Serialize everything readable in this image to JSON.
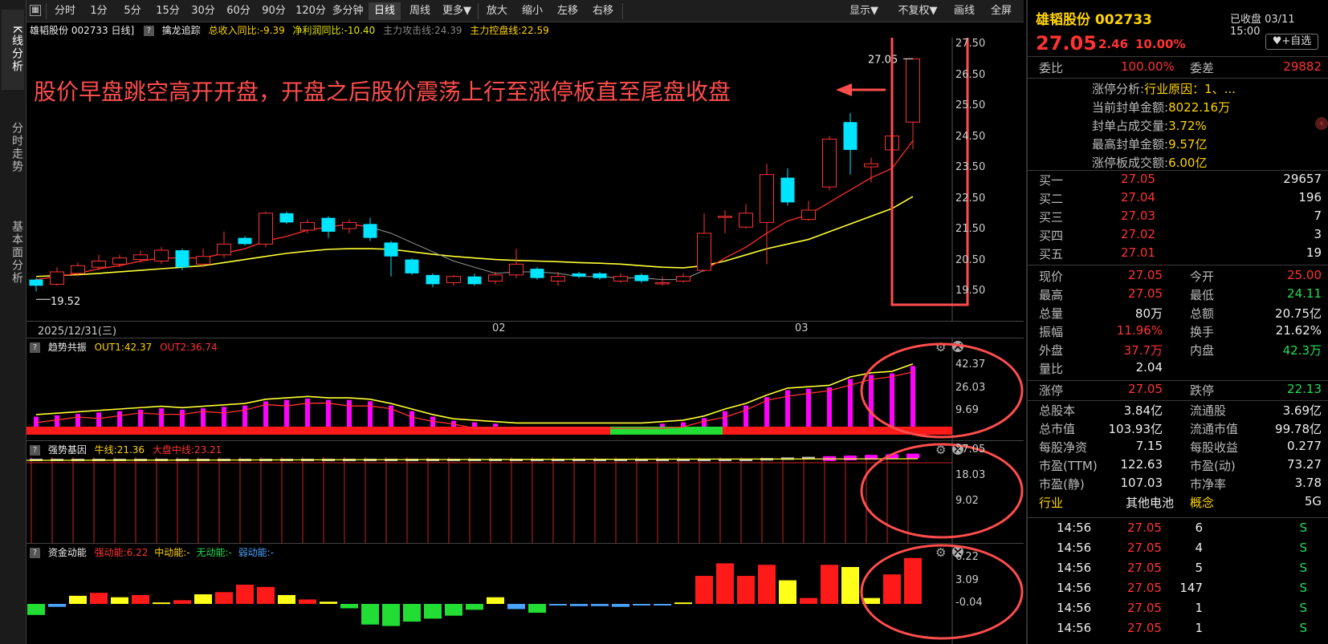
{
  "sidebar": {
    "tabs": [
      {
        "label": "K线分析",
        "active": true
      },
      {
        "label": "分时走势",
        "active": false
      },
      {
        "label": "基本面分析",
        "active": false
      }
    ]
  },
  "toolbar": {
    "periods": [
      "分时",
      "1分",
      "5分",
      "15分",
      "30分",
      "60分",
      "90分",
      "120分",
      "多分钟",
      "日线",
      "周线",
      "更多▼"
    ],
    "active_period": "日线",
    "actions": [
      "放大",
      "缩小",
      "左移",
      "右移"
    ],
    "right": [
      "显示▼",
      "不复权▼",
      "画线",
      "全屏"
    ]
  },
  "main_info": {
    "title": "雄韬股份 002733 日线]",
    "indicator": "擒龙追踪",
    "rev_yoy": "总收入同比:-9.39",
    "profit_yoy": "净利润同比:-10.40",
    "attack_line": "主力攻击线:24.39",
    "control_line": "主力控盘线:22.59"
  },
  "annotation": {
    "text": "股价早盘跳空高开开盘，开盘之后股价震荡上行至涨停板直至尾盘收盘"
  },
  "colors": {
    "up": "#ff3333",
    "down": "#00e5ff",
    "ma_yellow": "#ffff33",
    "ma_red": "#ff2a2a",
    "annotation": "#ff4d4d",
    "magenta": "#ff00ff"
  },
  "main_axis": {
    "ticks": [
      "27.50",
      "26.50",
      "25.50",
      "24.50",
      "23.50",
      "22.50",
      "21.50",
      "20.50",
      "19.50"
    ]
  },
  "date_axis": {
    "start": "2025/12/31(三)",
    "mid": "02",
    "end": "03"
  },
  "price_labels": {
    "high": "27.05",
    "low": "19.52"
  },
  "chart_data": [
    {
      "type": "candlestick",
      "title": "雄韬股份 002733 日线",
      "ylim": [
        19.5,
        27.5
      ],
      "candles": [
        {
          "o": 19.9,
          "c": 19.7,
          "h": 19.95,
          "l": 19.52
        },
        {
          "o": 19.75,
          "c": 20.15,
          "h": 20.3,
          "l": 19.7
        },
        {
          "o": 20.1,
          "c": 20.35,
          "h": 20.45,
          "l": 20.0
        },
        {
          "o": 20.3,
          "c": 20.5,
          "h": 20.7,
          "l": 20.2
        },
        {
          "o": 20.4,
          "c": 20.6,
          "h": 20.7,
          "l": 20.3
        },
        {
          "o": 20.55,
          "c": 20.7,
          "h": 20.85,
          "l": 20.45
        },
        {
          "o": 20.5,
          "c": 20.85,
          "h": 20.95,
          "l": 20.4
        },
        {
          "o": 20.85,
          "c": 20.3,
          "h": 20.9,
          "l": 20.2
        },
        {
          "o": 20.4,
          "c": 20.65,
          "h": 20.9,
          "l": 20.3
        },
        {
          "o": 20.7,
          "c": 21.05,
          "h": 21.45,
          "l": 20.6
        },
        {
          "o": 21.25,
          "c": 21.05,
          "h": 21.3,
          "l": 21.0
        },
        {
          "o": 21.05,
          "c": 22.05,
          "h": 22.1,
          "l": 20.95
        },
        {
          "o": 22.05,
          "c": 21.75,
          "h": 22.1,
          "l": 21.7
        },
        {
          "o": 21.5,
          "c": 21.75,
          "h": 21.85,
          "l": 21.4
        },
        {
          "o": 21.9,
          "c": 21.45,
          "h": 21.95,
          "l": 21.25
        },
        {
          "o": 21.55,
          "c": 21.75,
          "h": 21.85,
          "l": 21.4
        },
        {
          "o": 21.7,
          "c": 21.25,
          "h": 21.9,
          "l": 21.15
        },
        {
          "o": 21.1,
          "c": 20.65,
          "h": 21.15,
          "l": 20.0
        },
        {
          "o": 20.55,
          "c": 20.1,
          "h": 20.6,
          "l": 20.05
        },
        {
          "o": 20.05,
          "c": 19.75,
          "h": 20.1,
          "l": 19.65
        },
        {
          "o": 19.8,
          "c": 20.0,
          "h": 20.05,
          "l": 19.7
        },
        {
          "o": 20.0,
          "c": 19.75,
          "h": 20.1,
          "l": 19.7
        },
        {
          "o": 19.85,
          "c": 20.05,
          "h": 20.15,
          "l": 19.75
        },
        {
          "o": 20.05,
          "c": 20.4,
          "h": 20.9,
          "l": 19.95
        },
        {
          "o": 20.25,
          "c": 19.95,
          "h": 20.3,
          "l": 19.9
        },
        {
          "o": 19.85,
          "c": 20.0,
          "h": 20.15,
          "l": 19.7
        },
        {
          "o": 20.1,
          "c": 20.0,
          "h": 20.15,
          "l": 19.95
        },
        {
          "o": 20.1,
          "c": 19.95,
          "h": 20.15,
          "l": 19.9
        },
        {
          "o": 19.85,
          "c": 20.0,
          "h": 20.1,
          "l": 19.8
        },
        {
          "o": 20.05,
          "c": 19.85,
          "h": 20.1,
          "l": 19.8
        },
        {
          "o": 19.8,
          "c": 19.8,
          "h": 20.0,
          "l": 19.7
        },
        {
          "o": 19.85,
          "c": 20.0,
          "h": 20.1,
          "l": 19.8
        },
        {
          "o": 20.2,
          "c": 21.4,
          "h": 22.05,
          "l": 20.15
        },
        {
          "o": 21.95,
          "c": 21.95,
          "h": 22.15,
          "l": 21.4
        },
        {
          "o": 21.6,
          "c": 22.05,
          "h": 22.35,
          "l": 21.55
        },
        {
          "o": 21.75,
          "c": 23.3,
          "h": 23.65,
          "l": 20.4
        },
        {
          "o": 23.2,
          "c": 22.4,
          "h": 23.5,
          "l": 22.3
        },
        {
          "o": 21.85,
          "c": 22.15,
          "h": 22.45,
          "l": 21.8
        },
        {
          "o": 22.9,
          "c": 24.45,
          "h": 24.55,
          "l": 22.8
        },
        {
          "o": 25.0,
          "c": 24.1,
          "h": 25.3,
          "l": 23.3
        },
        {
          "o": 23.55,
          "c": 23.65,
          "h": 23.85,
          "l": 23.05
        },
        {
          "o": 24.1,
          "c": 24.55,
          "h": 25.95,
          "l": 24.05
        },
        {
          "o": 25.0,
          "c": 27.05,
          "h": 27.05,
          "l": 24.11
        }
      ],
      "ma_short": [
        19.9,
        20.0,
        20.1,
        20.25,
        20.35,
        20.5,
        20.6,
        20.6,
        20.6,
        20.75,
        20.9,
        21.15,
        21.3,
        21.5,
        21.6,
        21.7,
        21.6,
        21.4,
        21.1,
        20.8,
        20.5,
        20.3,
        20.1,
        20.15,
        20.15,
        20.1,
        20.0,
        20.0,
        19.95,
        19.95,
        19.9,
        19.9,
        20.2,
        20.6,
        20.95,
        21.4,
        21.8,
        22.0,
        22.4,
        22.8,
        23.2,
        23.5,
        24.4
      ],
      "ma_long": [
        20.0,
        20.03,
        20.06,
        20.1,
        20.15,
        20.2,
        20.25,
        20.3,
        20.35,
        20.45,
        20.55,
        20.65,
        20.75,
        20.82,
        20.88,
        20.9,
        20.9,
        20.88,
        20.8,
        20.72,
        20.65,
        20.6,
        20.55,
        20.52,
        20.5,
        20.48,
        20.45,
        20.43,
        20.4,
        20.35,
        20.3,
        20.28,
        20.35,
        20.5,
        20.7,
        20.9,
        21.05,
        21.2,
        21.45,
        21.7,
        21.95,
        22.2,
        22.59
      ]
    },
    {
      "type": "bar",
      "title": "趋势共振",
      "series": [
        {
          "name": "OUT1",
          "last": 42.37
        },
        {
          "name": "OUT2",
          "last": 36.74
        }
      ],
      "axis": {
        "ticks": [
          "42.37",
          "26.03",
          "9.69"
        ]
      },
      "values": [
        6,
        7,
        8,
        9,
        10,
        11,
        12,
        11,
        12,
        13,
        14,
        17,
        18,
        19,
        18,
        18,
        17,
        14,
        10,
        6,
        3,
        2,
        1,
        0,
        0,
        0,
        0,
        0,
        0,
        0,
        1,
        2,
        5,
        10,
        14,
        20,
        25,
        26,
        27,
        33,
        36,
        37,
        42.37
      ],
      "label_out1": "OUT1:42.37",
      "label_out2": "OUT2:36.74"
    },
    {
      "type": "bar",
      "title": "强势基因",
      "series": [
        {
          "name": "牛线",
          "last": 21.36
        },
        {
          "name": "大盘中线",
          "last": 23.21
        }
      ],
      "axis": {
        "ticks": [
          "27.05",
          "18.03",
          "9.02"
        ]
      },
      "label_bull": "牛线:21.36",
      "label_market": "大盘中线:23.21"
    },
    {
      "type": "bar",
      "title": "资金动能",
      "series": [
        {
          "name": "强动能",
          "last": 6.22
        },
        {
          "name": "中动能",
          "last": null
        },
        {
          "name": "无动能",
          "last": null
        },
        {
          "name": "弱动能",
          "last": null
        }
      ],
      "axis": {
        "ticks": [
          "6.22",
          "3.09",
          "-0.04"
        ]
      },
      "values": [
        -1.5,
        -0.4,
        1.1,
        1.5,
        0.9,
        1.2,
        0.2,
        0.5,
        1.3,
        1.6,
        2.6,
        2.3,
        1.2,
        0.6,
        0.3,
        -0.6,
        -2.8,
        -3.0,
        -2.4,
        -2.0,
        -1.6,
        -0.8,
        0.9,
        -0.7,
        -1.2,
        -0.2,
        -0.3,
        -0.3,
        -0.4,
        -0.2,
        -0.2,
        0.2,
        3.8,
        5.5,
        3.8,
        5.3,
        3.2,
        0.8,
        5.3,
        5.0,
        0.8,
        4.0,
        6.22
      ],
      "label_strong": "强动能:6.22",
      "label_mid": "中动能:-",
      "label_none": "无动能:-",
      "label_weak": "弱动能:-"
    }
  ],
  "quote": {
    "name": "雄韬股份 002733",
    "status": "已收盘 03/11 15:00",
    "price": "27.05",
    "change": "2.46",
    "pct": "10.00%",
    "fav_button": "+自选",
    "wei_bi_label": "委比",
    "wei_bi": "100.00%",
    "wei_cha_label": "委差",
    "wei_cha": "29882",
    "limit_analysis_label": "涨停分析:",
    "limit_analysis": "行业原因：1、...",
    "seal_amount_label": "当前封单金额:",
    "seal_amount": "8022.16万",
    "seal_ratio_label": "封单占成交量:",
    "seal_ratio": "3.72%",
    "max_seal_label": "最高封单金额:",
    "max_seal": "9.57亿",
    "limit_turnover_label": "涨停板成交额:",
    "limit_turnover": "6.00亿",
    "bids": [
      {
        "label": "买一",
        "price": "27.05",
        "vol": "29657"
      },
      {
        "label": "买二",
        "price": "27.04",
        "vol": "196"
      },
      {
        "label": "买三",
        "price": "27.03",
        "vol": "7"
      },
      {
        "label": "买四",
        "price": "27.02",
        "vol": "3"
      },
      {
        "label": "买五",
        "price": "27.01",
        "vol": "19"
      }
    ],
    "stats": [
      {
        "l1": "现价",
        "v1": "27.05",
        "c1": "red",
        "l2": "今开",
        "v2": "25.00",
        "c2": "red"
      },
      {
        "l1": "最高",
        "v1": "27.05",
        "c1": "red",
        "l2": "最低",
        "v2": "24.11",
        "c2": "green"
      },
      {
        "l1": "总量",
        "v1": "80万",
        "c1": "white",
        "l2": "总额",
        "v2": "20.75亿",
        "c2": "white"
      },
      {
        "l1": "振幅",
        "v1": "11.96%",
        "c1": "red",
        "l2": "换手",
        "v2": "21.62%",
        "c2": "white"
      },
      {
        "l1": "外盘",
        "v1": "37.7万",
        "c1": "red",
        "l2": "内盘",
        "v2": "42.3万",
        "c2": "green"
      },
      {
        "l1": "量比",
        "v1": "2.04",
        "c1": "white",
        "l2": "",
        "v2": "",
        "c2": "white"
      },
      {
        "l1": "涨停",
        "v1": "27.05",
        "c1": "red",
        "l2": "跌停",
        "v2": "22.13",
        "c2": "green"
      },
      {
        "l1": "总股本",
        "v1": "3.84亿",
        "c1": "white",
        "l2": "流通股",
        "v2": "3.69亿",
        "c2": "white"
      },
      {
        "l1": "总市值",
        "v1": "103.93亿",
        "c1": "white",
        "l2": "流通市值",
        "v2": "99.78亿",
        "c2": "white"
      },
      {
        "l1": "每股净资",
        "v1": "7.15",
        "c1": "white",
        "l2": "每股收益",
        "v2": "0.277",
        "c2": "white"
      },
      {
        "l1": "市盈(TTM)",
        "v1": "122.63",
        "c1": "white",
        "l2": "市盈(动)",
        "v2": "73.27",
        "c2": "white"
      },
      {
        "l1": "市盈(静)",
        "v1": "107.03",
        "c1": "white",
        "l2": "市净率",
        "v2": "3.78",
        "c2": "white"
      },
      {
        "l1": "行业",
        "v1": "其他电池",
        "c1": "white",
        "l2": "概念",
        "v2": "5G",
        "c2": "white"
      }
    ],
    "ticks": [
      {
        "time": "14:56",
        "price": "27.05",
        "vol": "6",
        "side": "S"
      },
      {
        "time": "14:56",
        "price": "27.05",
        "vol": "4",
        "side": "S"
      },
      {
        "time": "14:56",
        "price": "27.05",
        "vol": "5",
        "side": "S"
      },
      {
        "time": "14:56",
        "price": "27.05",
        "vol": "147",
        "side": "S"
      },
      {
        "time": "14:56",
        "price": "27.05",
        "vol": "1",
        "side": "S"
      },
      {
        "time": "14:56",
        "price": "27.05",
        "vol": "1",
        "side": "S"
      }
    ]
  }
}
